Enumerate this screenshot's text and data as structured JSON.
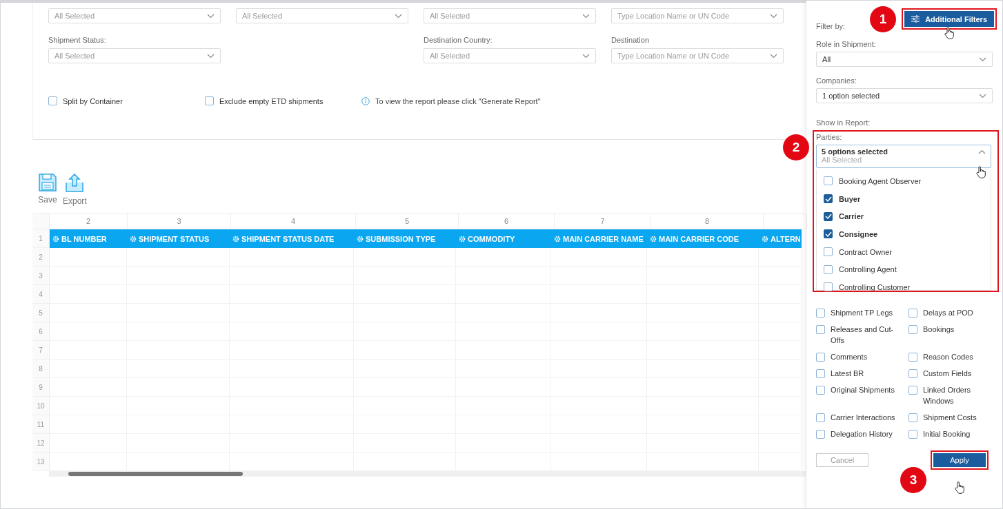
{
  "filters": {
    "fields": [
      {
        "kind": "select",
        "placeholder": "All Selected"
      },
      {
        "kind": "select",
        "placeholder": "All Selected"
      },
      {
        "kind": "select",
        "placeholder": "All Selected"
      },
      {
        "kind": "select",
        "placeholder": "Type Location Name or UN Code"
      },
      {
        "kind": "select",
        "label": "Shipment Status:",
        "placeholder": "All Selected"
      },
      {
        "kind": "empty"
      },
      {
        "kind": "select",
        "label": "Destination Country:",
        "placeholder": "All Selected"
      },
      {
        "kind": "select",
        "label": "Destination",
        "placeholder": "Type Location Name or UN Code"
      }
    ],
    "options": [
      {
        "label": "Split by Container",
        "checked": false
      },
      {
        "label": "Exclude empty ETD shipments",
        "checked": false
      }
    ],
    "info": "To view the report please click \"Generate Report\""
  },
  "toolbar": [
    {
      "kind": "save",
      "label": "Save"
    },
    {
      "kind": "export",
      "label": "Export"
    }
  ],
  "table": {
    "column_numbers": [
      "2",
      "3",
      "4",
      "5",
      "6",
      "7",
      "8"
    ],
    "columns": [
      "BL NUMBER",
      "SHIPMENT STATUS",
      "SHIPMENT STATUS DATE",
      "SUBMISSION TYPE",
      "COMMODITY",
      "MAIN CARRIER NAME",
      "MAIN CARRIER CODE",
      "ALTERN"
    ],
    "row_numbers": [
      "1",
      "2",
      "3",
      "4",
      "5",
      "6",
      "7",
      "8",
      "9",
      "10",
      "11",
      "12",
      "13"
    ]
  },
  "panel": {
    "title": "Filter by:",
    "additional_filters": "Additional Filters",
    "role": {
      "label": "Role in Shipment:",
      "value": "All"
    },
    "companies": {
      "label": "Companies:",
      "value": "1 option selected"
    },
    "show_in_report": "Show in Report:",
    "parties": {
      "label": "Parties:",
      "value": "5 options selected",
      "placeholder": "All Selected",
      "options": [
        {
          "label": "Booking Agent Observer",
          "checked": false
        },
        {
          "label": "Buyer",
          "checked": true
        },
        {
          "label": "Carrier",
          "checked": true
        },
        {
          "label": "Consignee",
          "checked": true
        },
        {
          "label": "Contract Owner",
          "checked": false
        },
        {
          "label": "Controlling Agent",
          "checked": false
        },
        {
          "label": "Controlling Customer",
          "checked": false
        }
      ]
    },
    "report_items": [
      {
        "label": "Shipment TP Legs",
        "checked": false
      },
      {
        "label": "Delays at POD",
        "checked": false
      },
      {
        "label": "Releases and Cut-Offs",
        "checked": false
      },
      {
        "label": "Bookings",
        "checked": false
      },
      {
        "label": "Comments",
        "checked": false
      },
      {
        "label": "Reason Codes",
        "checked": false
      },
      {
        "label": "Latest BR",
        "checked": false
      },
      {
        "label": "Custom Fields",
        "checked": false
      },
      {
        "label": "Original Shipments",
        "checked": false
      },
      {
        "label": "Linked Orders Windows",
        "checked": false
      },
      {
        "label": "Carrier Interactions",
        "checked": false
      },
      {
        "label": "Shipment Costs",
        "checked": false
      },
      {
        "label": "Delegation History",
        "checked": false
      },
      {
        "label": "Initial Booking",
        "checked": false
      }
    ],
    "cancel": "Cancel",
    "apply": "Apply"
  },
  "callouts": [
    "1",
    "2",
    "3"
  ]
}
